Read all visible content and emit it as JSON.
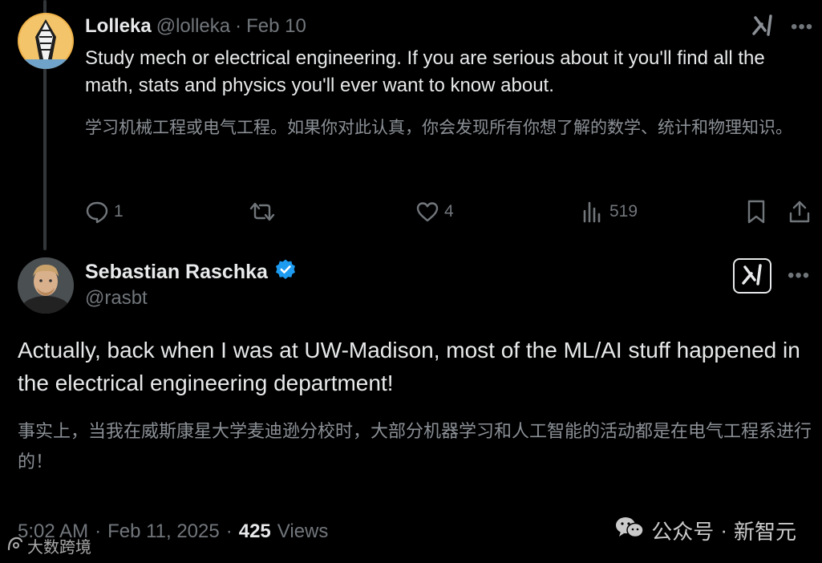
{
  "reply": {
    "display_name": "Lolleka",
    "handle": "@lolleka",
    "separator": "·",
    "date": "Feb 10",
    "text": "Study mech or electrical engineering. If you are serious about it you'll find all the math, stats and physics you'll ever want to know about.",
    "translation": "学习机械工程或电气工程。如果你对此认真，你会发现所有你想了解的数学、统计和物理知识。",
    "actions": {
      "replies": "1",
      "retweets": "",
      "likes": "4",
      "views": "519"
    },
    "more": "•••"
  },
  "main": {
    "display_name": "Sebastian Raschka",
    "handle": "@rasbt",
    "verified": true,
    "verified_color": "#1d9bf0",
    "text": "Actually, back when I was at UW-Madison, most of the ML/AI stuff happened in the electrical engineering department!",
    "translation": "事实上，当我在威斯康星大学麦迪逊分校时，大部分机器学习和人工智能的活动都是在电气工程系进行的！",
    "time": "5:02 AM",
    "separator": "·",
    "date": "Feb 11, 2025",
    "views_count": "425",
    "views_label": "Views",
    "more": "•••"
  },
  "icons": {
    "reply": "comment-bubble-icon",
    "retweet": "retweet-icon",
    "like": "heart-icon",
    "views": "bar-chart-icon",
    "bookmark": "bookmark-icon",
    "share": "share-upload-icon",
    "grok": "grok-icon",
    "verified": "verified-badge-icon"
  },
  "watermarks": {
    "left": "大数跨境",
    "right_brand": "公众号",
    "right_dot": "·",
    "right_name": "新智元"
  }
}
